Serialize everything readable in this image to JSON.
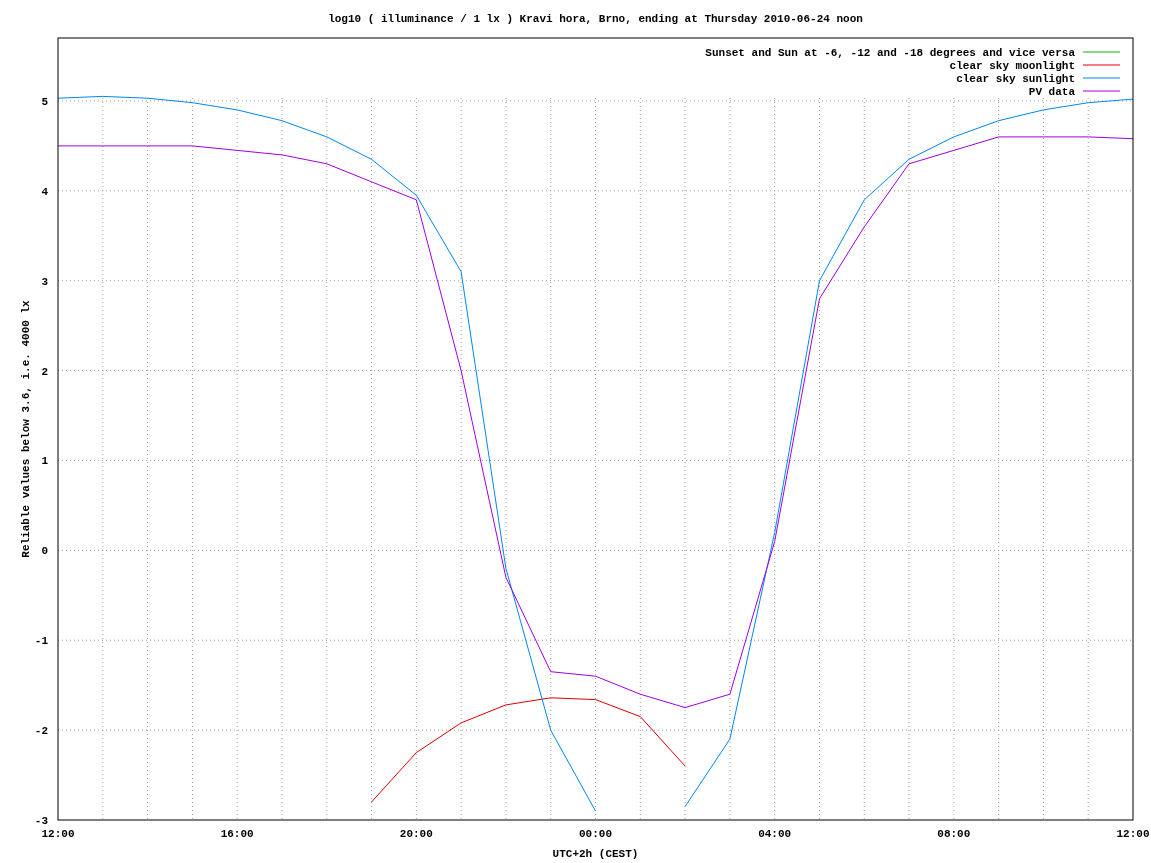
{
  "chart_data": {
    "type": "line",
    "title": "log10 ( illuminance / 1 lx ) Kravi hora, Brno, ending at Thursday 2010-06-24 noon",
    "xlabel": "UTC+2h (CEST)",
    "ylabel": "Reliable values below 3.6, i.e. 4000 lx",
    "categories": [
      "12:00",
      null,
      null,
      null,
      "16:00",
      null,
      null,
      null,
      "20:00",
      null,
      null,
      null,
      "00:00",
      null,
      null,
      null,
      "04:00",
      null,
      null,
      null,
      "08:00",
      null,
      null,
      null,
      "12:00"
    ],
    "series": [
      {
        "name": "Sunset and Sun at -6, -12 and -18 degrees and vice versa",
        "color": "#00c000",
        "values": [
          null,
          null,
          null,
          null,
          null,
          null,
          null,
          null,
          null,
          null,
          null,
          null,
          null,
          null,
          null,
          null,
          null,
          null,
          null,
          null,
          null,
          null,
          null,
          null,
          null
        ]
      },
      {
        "name": "clear sky moonlight",
        "color": "#e00000",
        "values": [
          null,
          null,
          null,
          null,
          null,
          null,
          null,
          -2.8,
          -2.25,
          -1.92,
          -1.72,
          -1.64,
          -1.66,
          -1.85,
          -2.4,
          null,
          null,
          null,
          null,
          null,
          null,
          null,
          null,
          null,
          null
        ]
      },
      {
        "name": "clear sky sunlight",
        "color": "#0088ee",
        "values": [
          5.03,
          5.05,
          5.03,
          4.98,
          4.9,
          4.78,
          4.6,
          4.35,
          3.95,
          3.1,
          -0.2,
          -2.0,
          -2.9,
          null,
          -2.85,
          -2.1,
          0.2,
          3.0,
          3.9,
          4.35,
          4.6,
          4.78,
          4.9,
          4.98,
          5.02
        ]
      },
      {
        "name": "PV data",
        "color": "#a000e0",
        "values": [
          4.5,
          4.5,
          4.5,
          4.5,
          4.45,
          4.4,
          4.3,
          4.1,
          3.9,
          2.0,
          -0.3,
          -1.35,
          -1.4,
          -1.6,
          -1.75,
          -1.6,
          0.1,
          2.8,
          3.6,
          4.3,
          4.45,
          4.6,
          4.6,
          4.6,
          4.58
        ]
      }
    ],
    "ylim": [
      -3,
      5.7
    ],
    "grid": true,
    "legend": true,
    "yticks": [
      -3,
      -2,
      -1,
      0,
      1,
      2,
      3,
      4,
      5
    ]
  }
}
